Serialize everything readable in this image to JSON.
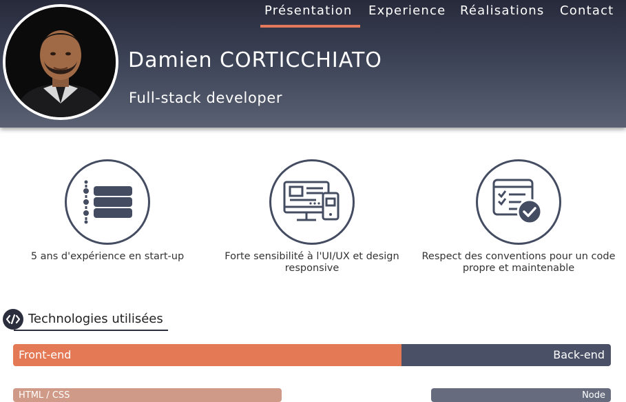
{
  "header": {
    "name": "Damien CORTICCHIATO",
    "role": "Full-stack developer",
    "background_colors": [
      "#272a3b",
      "#5a6173"
    ]
  },
  "nav": {
    "items": [
      {
        "label": "Présentation",
        "active": true
      },
      {
        "label": "Experience",
        "active": false
      },
      {
        "label": "Réalisations",
        "active": false
      },
      {
        "label": "Contact",
        "active": false
      }
    ],
    "active_color": "#e4785a"
  },
  "features": [
    {
      "icon": "list-icon",
      "caption": "5 ans d'expérience en start-up"
    },
    {
      "icon": "responsive-devices-icon",
      "caption": "Forte sensibilité à l'UI/UX et design responsive"
    },
    {
      "icon": "checklist-approved-icon",
      "caption": "Respect des conventions pour un code propre et maintenable"
    }
  ],
  "technologies": {
    "title": "Technologies utilisées",
    "icon": "code-icon",
    "front_label": "Front-end",
    "back_label": "Back-end",
    "front_color": "#e47956",
    "back_color": "#4a5066",
    "front_share": 0.65,
    "skill_left_label": "HTML / CSS",
    "skill_right_label": "Node"
  }
}
